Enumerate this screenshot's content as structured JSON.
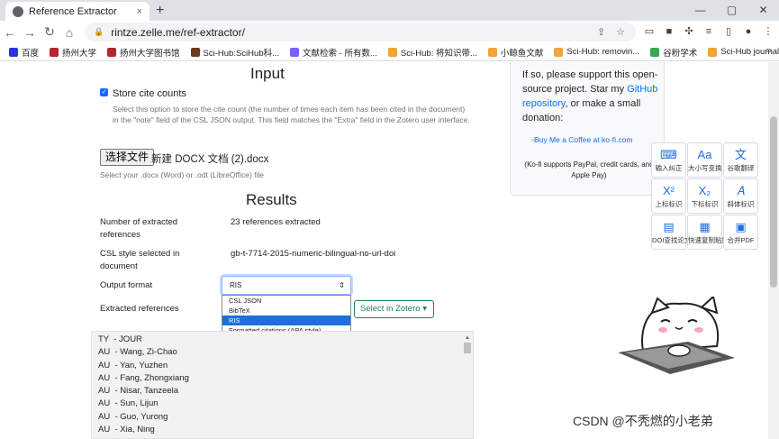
{
  "browser": {
    "tab_title": "Reference Extractor",
    "tab_close": "×",
    "new_tab": "+",
    "url": "rintze.zelle.me/ref-extractor/",
    "window_controls": [
      "—",
      "▢",
      "✕"
    ],
    "bookmarks": [
      {
        "label": "百度",
        "color": "#2932e1"
      },
      {
        "label": "扬州大学",
        "color": "#b8232e"
      },
      {
        "label": "扬州大学图书馆",
        "color": "#b8232e"
      },
      {
        "label": "Sci-Hub:SciHub科...",
        "color": "#6b3a1e"
      },
      {
        "label": "文献检索 - 所有数...",
        "color": "#7b61ff"
      },
      {
        "label": "Sci-Hub: 将知识带...",
        "color": "#f2a33a"
      },
      {
        "label": "小鲸鱼文献",
        "color": "#f2a33a"
      },
      {
        "label": "Sci-Hub: removin...",
        "color": "#f2a33a"
      },
      {
        "label": "谷粉学术",
        "color": "#34a853"
      },
      {
        "label": "Sci-Hub journal:la...",
        "color": "#f2a33a"
      }
    ],
    "bookmarks_more": "»"
  },
  "main": {
    "input_heading": "Input",
    "store_cite_label": "Store cite counts",
    "store_cite_checked": true,
    "store_cite_help": "Select this option to store the cite count (the number of times each item has been cited in the document) in the \"note\" field of the CSL JSON output. This field matches the \"Extra\" field in the Zotero user interface.",
    "file_button": "选择文件",
    "file_name": "新建 DOCX 文档 (2).docx",
    "file_help": "Select your .docx (Word) or .odt (LibreOffice) file",
    "results_heading": "Results",
    "extracted_count_label": "Number of extracted references",
    "extracted_count_value": "23 references extracted",
    "csl_label": "CSL style selected in document",
    "csl_value": "gb-t-7714-2015-numeric-bilingual-no-url-doi",
    "output_format_label": "Output format",
    "output_format_value": "RIS",
    "output_format_options": [
      "CSL JSON",
      "BibTeX",
      "RIS",
      "Formatted citations (APA style)"
    ],
    "output_format_selected_index": 2,
    "extracted_refs_label": "Extracted references",
    "zotero_button": "Select in Zotero",
    "ris_lines": [
      "TY  - JOUR",
      "AU  - Wang, Zi-Chao",
      "AU  - Yan, Yuzhen",
      "AU  - Fang, Zhongxiang",
      "AU  - Nisar, Tanzeela",
      "AU  - Sun, Lijun",
      "AU  - Guo, Yurong",
      "AU  - Xia, Ning"
    ]
  },
  "sidebar": {
    "support_text_1": "If so, please support this open-source project. Star my ",
    "support_link": "GitHub repository",
    "support_text_2": ", or make a small donation:",
    "kofi_link": "Buy Me a Coffee at ko-fi.com",
    "kofi_note": "(Ko-fi supports PayPal, credit cards, and Apple Pay)"
  },
  "tools_panel": [
    {
      "label": "输入纠正",
      "icon": "⌨"
    },
    {
      "label": "大小写变换",
      "icon": "Aa"
    },
    {
      "label": "谷歌翻译",
      "icon": "文"
    },
    {
      "label": "上标标识",
      "icon": "X²"
    },
    {
      "label": "下标标识",
      "icon": "X₂"
    },
    {
      "label": "斜体标识",
      "icon": "𝐴"
    },
    {
      "label": "DOI查找论文",
      "icon": "▤"
    },
    {
      "label": "快速复制粘贴",
      "icon": "▦"
    },
    {
      "label": "合并PDF",
      "icon": "▣"
    }
  ],
  "watermark": "CSDN @不秃燃的小老弟"
}
